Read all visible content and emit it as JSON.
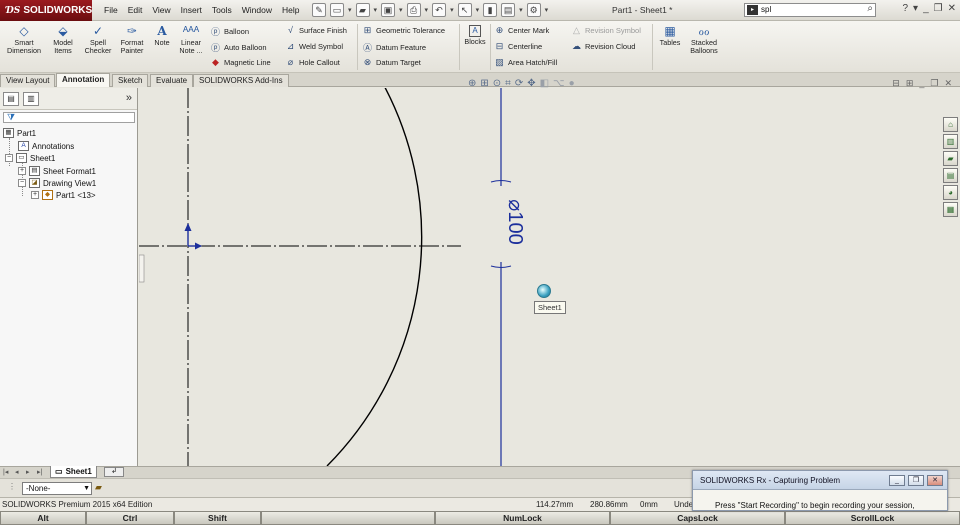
{
  "app": {
    "logo_text": "SOLIDWORKS",
    "doc_title": "Part1 - Sheet1 *"
  },
  "menu": [
    "File",
    "Edit",
    "View",
    "Insert",
    "Tools",
    "Window",
    "Help"
  ],
  "search": {
    "value": "spl"
  },
  "ribbon": {
    "smart_dimension": "Smart Dimension",
    "model_items": "Model Items",
    "spell_checker": "Spell Checker",
    "format_painter": "Format Painter",
    "note": "Note",
    "linear_note": "Linear Note ...",
    "balloon": "Balloon",
    "auto_balloon": "Auto Balloon",
    "magnetic_line": "Magnetic Line",
    "surface_finish": "Surface Finish",
    "weld_symbol": "Weld Symbol",
    "hole_callout": "Hole Callout",
    "geometric_tolerance": "Geometric Tolerance",
    "datum_feature": "Datum Feature",
    "datum_target": "Datum Target",
    "blocks": "Blocks",
    "center_mark": "Center Mark",
    "centerline": "Centerline",
    "area_hatch": "Area Hatch/Fill",
    "revision_symbol": "Revision Symbol",
    "revision_cloud": "Revision Cloud",
    "tables": "Tables",
    "stacked_balloons": "Stacked Balloons"
  },
  "tabs": [
    "View Layout",
    "Annotation",
    "Sketch",
    "Evaluate",
    "SOLIDWORKS Add-Ins"
  ],
  "active_tab": "Annotation",
  "tree": {
    "root": "Part1",
    "annotations": "Annotations",
    "sheet": "Sheet1",
    "sheet_format": "Sheet Format1",
    "drawing_view": "Drawing View1",
    "part": "Part1 <13>"
  },
  "drawing": {
    "dimension_text": "⌀100",
    "tooltip": "Sheet1"
  },
  "sheet_tab": "Sheet1",
  "layer": "-None-",
  "status": {
    "edition": "SOLIDWORKS Premium 2015 x64 Edition",
    "x": "114.27mm",
    "y": "280.86mm",
    "z": "0mm",
    "state": "Unde"
  },
  "keys": [
    "Alt",
    "Ctrl",
    "Shift",
    "",
    "NumLock",
    "CapsLock",
    "ScrollLock"
  ],
  "rx_window": {
    "title": "SOLIDWORKS Rx - Capturing Problem",
    "message": "Press \"Start Recording\" to begin recording your session,"
  },
  "colors": {
    "brand": "#8b1a1f",
    "dimension_line": "#1c2f9c",
    "geometry": "#000000"
  }
}
